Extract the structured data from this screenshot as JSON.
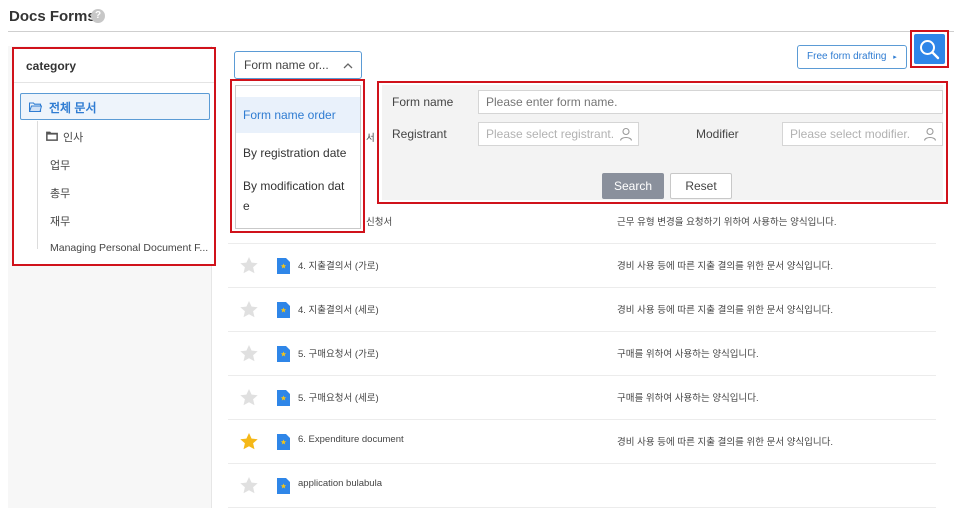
{
  "header": {
    "title": "Docs Forms",
    "help_glyph": "?"
  },
  "category": {
    "title": "category",
    "root": "전체 문서",
    "items": [
      "인사",
      "업무",
      "총무",
      "재무",
      "Managing Personal Document F..."
    ]
  },
  "sort": {
    "selected": "Form name or...",
    "options": [
      "Form name order",
      "By registration date",
      "By modification dat",
      "e"
    ]
  },
  "toolbar": {
    "free_form_label": "Free form drafting",
    "free_form_arrow": "▸"
  },
  "search": {
    "form_name_label": "Form name",
    "form_name_placeholder": "Please enter form name.",
    "registrant_label": "Registrant",
    "registrant_placeholder": "Please select registrant.",
    "modifier_label": "Modifier",
    "modifier_placeholder": "Please select modifier.",
    "search_button": "Search",
    "reset_button": "Reset"
  },
  "forms": [
    {
      "name": "서",
      "description": "",
      "starred": false,
      "partial": "row1"
    },
    {
      "name": "신청서",
      "description": "근무 유형 변경을 요청하기 위하여 사용하는 양식입니다.",
      "starred": false
    },
    {
      "name": "4. 지출결의서 (가로)",
      "description": "경비 사용 등에 따른 지출 결의를 위한 문서 양식입니다.",
      "starred": false
    },
    {
      "name": "4. 지출결의서 (세로)",
      "description": "경비 사용 등에 따른 지출 결의를 위한 문서 양식입니다.",
      "starred": false
    },
    {
      "name": "5. 구매요청서 (가로)",
      "description": "구매를 위하여 사용하는 양식입니다.",
      "starred": false
    },
    {
      "name": "5. 구매요청서 (세로)",
      "description": "구매를 위하여 사용하는 양식입니다.",
      "starred": false
    },
    {
      "name": "6. Expenditure document",
      "description": "경비 사용 등에 따른 지출 결의를 위한 문서 양식입니다.",
      "starred": true
    },
    {
      "name": "application bulabula",
      "description": "",
      "starred": false
    }
  ],
  "colors": {
    "accent": "#2f86e8",
    "highlight": "#d0121b",
    "star_on": "#f5b818",
    "star_off": "#e0e0e0"
  }
}
